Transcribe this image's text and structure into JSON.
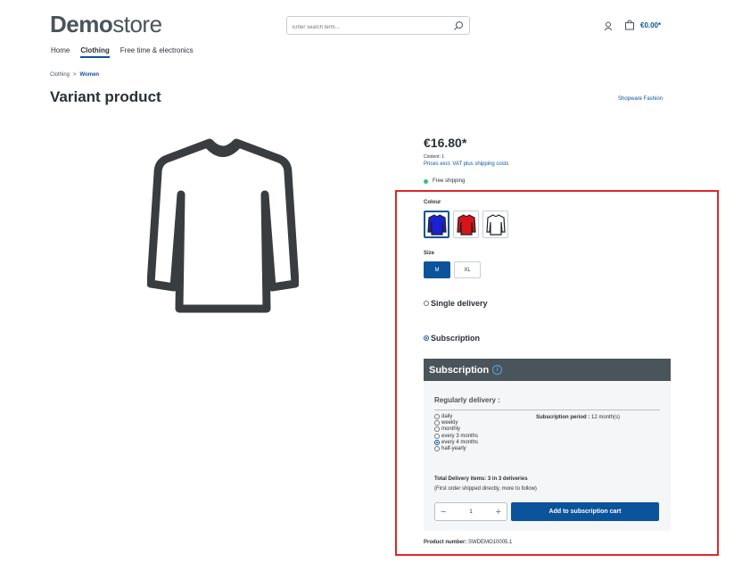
{
  "header": {
    "logo_bold": "Demo",
    "logo_light": "store",
    "search_placeholder": "Enter search term...",
    "cart_total": "€0.00*"
  },
  "nav": {
    "items": [
      "Home",
      "Clothing",
      "Free time & electronics"
    ],
    "active": "Clothing"
  },
  "breadcrumb": {
    "parent": "Clothing",
    "separator": ">",
    "current": "Women"
  },
  "product": {
    "title": "Variant product",
    "manufacturer": "Shopware Fashion",
    "price": "€16.80*",
    "content": "Content: 1",
    "tax_note": "Prices excl. VAT plus shipping costs",
    "shipping": "Free shipping",
    "colour_label": "Colour",
    "colours": [
      {
        "name": "blue",
        "hex": "#1b1fd6",
        "selected": true
      },
      {
        "name": "red",
        "hex": "#d7141a",
        "selected": false
      },
      {
        "name": "white",
        "hex": "#ffffff",
        "selected": false
      }
    ],
    "size_label": "Size",
    "sizes": [
      {
        "label": "M",
        "selected": true
      },
      {
        "label": "XL",
        "selected": false
      }
    ],
    "product_number_label": "Product number:",
    "product_number": "SWDEMO10005.1"
  },
  "delivery": {
    "single_label": "Single delivery",
    "subscription_label": "Subscription",
    "selected": "subscription"
  },
  "subscription": {
    "header": "Subscription",
    "regular_title": "Regularly delivery :",
    "intervals": [
      {
        "label": "daily",
        "selected": false
      },
      {
        "label": "weekly",
        "selected": false
      },
      {
        "label": "monthly",
        "selected": false
      },
      {
        "label": "every 3 months",
        "selected": false
      },
      {
        "label": "every 4 months",
        "selected": true
      },
      {
        "label": "half-yearly",
        "selected": false
      }
    ],
    "period_label": "Subscription period :",
    "period_value": "12 month(s)",
    "total_items": "Total Delivery items: 3 in 3 deliveries",
    "note": "(First order shipped directly, more to follow)",
    "quantity": "1",
    "add_button": "Add to subscription cart"
  },
  "colors": {
    "primary": "#0b539b",
    "highlight": "#e3262a",
    "header_dark": "#4a545b"
  }
}
